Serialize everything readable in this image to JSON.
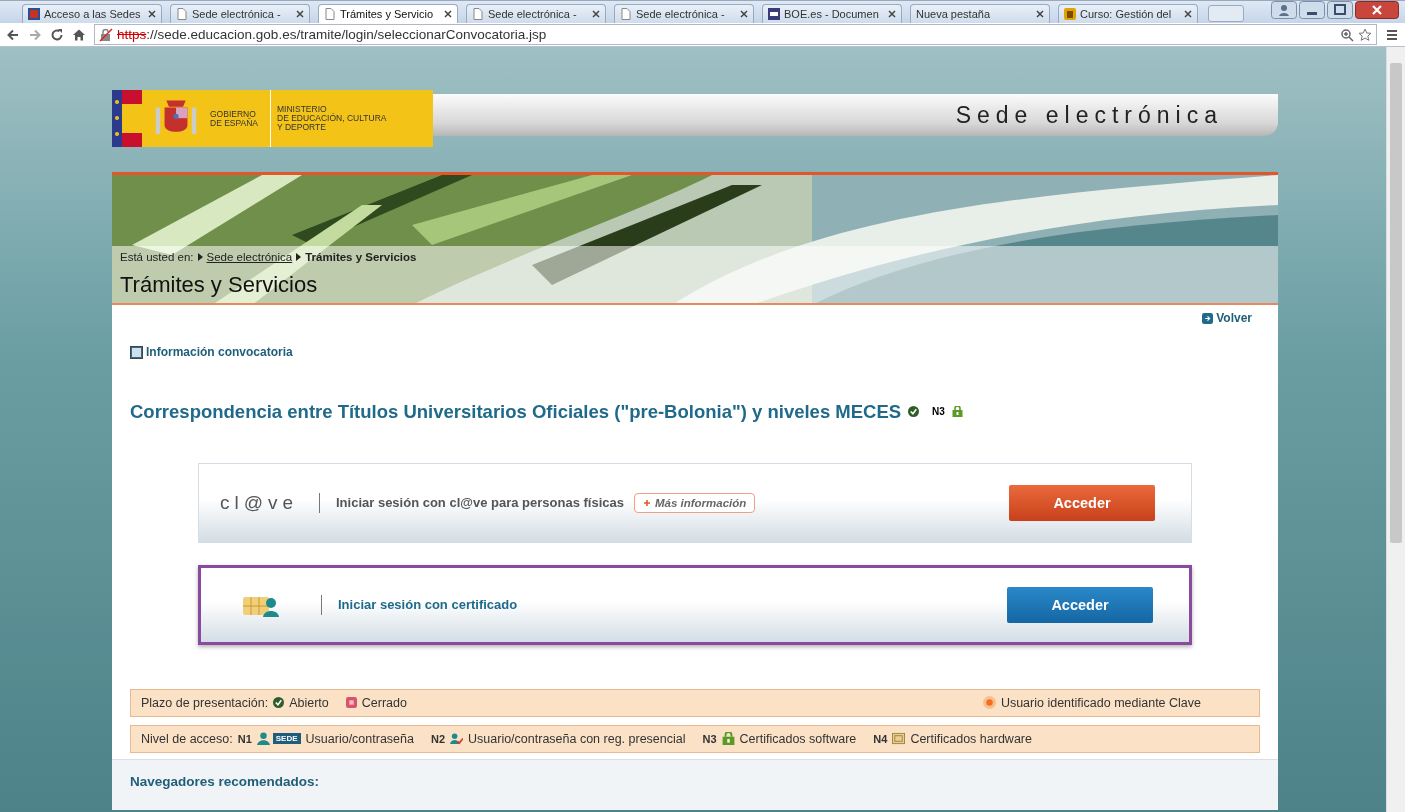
{
  "browser": {
    "tabs": [
      {
        "title": "Acceso a las Sedes",
        "kind": "site",
        "selected": false
      },
      {
        "title": "Sede electrónica -",
        "kind": "page",
        "selected": false
      },
      {
        "title": "Trámites y Servicio",
        "kind": "page",
        "selected": true
      },
      {
        "title": "Sede electrónica -",
        "kind": "page",
        "selected": false
      },
      {
        "title": "Sede electrónica -",
        "kind": "page",
        "selected": false
      },
      {
        "title": "BOE.es - Documen",
        "kind": "boe",
        "selected": false
      },
      {
        "title": "Nueva pestaña",
        "kind": "blank",
        "selected": false
      },
      {
        "title": "Curso: Gestión del",
        "kind": "course",
        "selected": false
      }
    ],
    "address": {
      "scheme": "https",
      "rest": "://sede.educacion.gob.es/tramite/login/seleccionarConvocatoria.jsp"
    }
  },
  "header": {
    "government": [
      "GOBIERNO",
      "DE ESPAÑA"
    ],
    "ministry": [
      "MINISTERIO",
      "DE EDUCACIÓN, CULTURA",
      "Y DEPORTE"
    ],
    "site_title": "Sede electrónica"
  },
  "breadcrumb": {
    "label": "Está usted en:",
    "items": [
      {
        "text": "Sede electrónica",
        "kind": "link"
      },
      {
        "text": "Trámites y Servicios",
        "kind": "current"
      }
    ]
  },
  "page_title": "Trámites y Servicios",
  "back_link": "Volver",
  "info_link": "Información convocatoria",
  "procedure": {
    "title": "Correspondencia entre Títulos Universitarios Oficiales (\"pre-Bolonia\") y niveles MECES",
    "open": true,
    "level": "N3"
  },
  "login_options": [
    {
      "kind": "clave",
      "logo": "cl@ve",
      "label": "Iniciar sesión con cl@ve para personas físicas",
      "more_info": "Más información",
      "button": "Acceder",
      "highlighted": false
    },
    {
      "kind": "certificate",
      "label": "Iniciar sesión con certificado",
      "button": "Acceder",
      "highlighted": true
    }
  ],
  "deadline_legend": {
    "label": "Plazo de presentación:",
    "items": [
      {
        "kind": "open",
        "text": "Abierto"
      },
      {
        "kind": "closed",
        "text": "Cerrado"
      }
    ],
    "note": "Usuario identificado mediante Clave"
  },
  "access_legend": {
    "label": "Nivel de acceso:",
    "items": [
      {
        "code": "N1",
        "kind": "user",
        "badge": "SEDE",
        "text": "Usuario/contraseña"
      },
      {
        "code": "N2",
        "kind": "user-check",
        "text": "Usuario/contraseña con reg. presencial"
      },
      {
        "code": "N3",
        "kind": "software",
        "text": "Certificados software"
      },
      {
        "code": "N4",
        "kind": "hardware",
        "text": "Certificados hardware"
      }
    ]
  },
  "footer": {
    "heading": "Navegadores recomendados:"
  }
}
